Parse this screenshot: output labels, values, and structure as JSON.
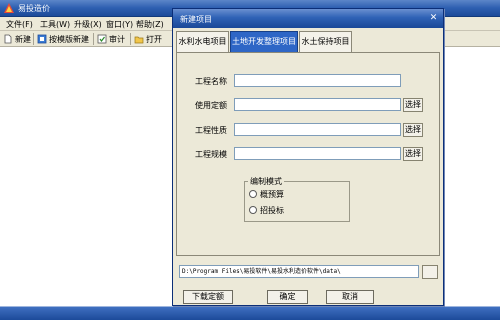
{
  "app": {
    "title": "易投造价",
    "menu": [
      "文件(F)",
      "工具(W)",
      "升级(X)",
      "窗口(Y)",
      "帮助(Z)"
    ],
    "toolbar": {
      "new": "新建",
      "new_from_template": "按模版新建",
      "audit": "审计",
      "open": "打开"
    }
  },
  "dialog": {
    "title": "新建项目",
    "close_glyph": "✕",
    "tabs": [
      {
        "label": "水利水电项目",
        "active": false
      },
      {
        "label": "土地开发整理项目",
        "active": true
      },
      {
        "label": "水土保持项目",
        "active": false
      }
    ],
    "form": {
      "project_name_label": "工程名称",
      "project_name_value": "",
      "quota_label": "使用定额",
      "quota_value": "",
      "nature_label": "工程性质",
      "nature_value": "",
      "scale_label": "工程规模",
      "scale_value": "",
      "select_label": "选择"
    },
    "mode": {
      "legend": "编制模式",
      "options": [
        "概预算",
        "招投标"
      ]
    },
    "path": "D:\\Program Files\\易投软件\\易投水利造价软件\\data\\",
    "buttons": {
      "download_quota": "下载定额",
      "ok": "确定",
      "cancel": "取消"
    }
  },
  "colors": {
    "titlebar_blue": "#2d5fb0",
    "active_tab": "#2e66c6",
    "dialog_bg": "#ece9d8",
    "workspace_bg": "#ffffff"
  }
}
